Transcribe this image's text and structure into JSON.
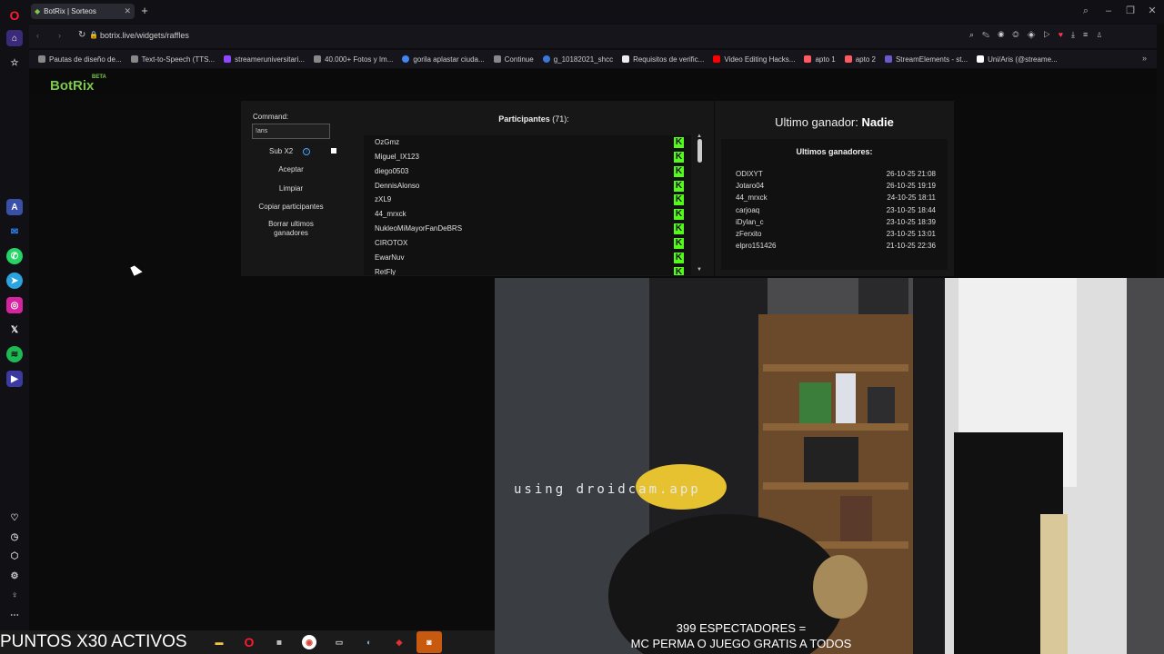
{
  "browser": {
    "tab_title": "BotRix | Sorteos",
    "url": "botrix.live/widgets/raffles",
    "bookmarks": [
      "Pautas de diseño de...",
      "Text-to-Speech (TTS...",
      "streameruniversitari...",
      "40.000+ Fotos y Im...",
      "gorila aplastar ciuda...",
      "Continue",
      "g_10182021_shcc",
      "Requisitos de verific...",
      "Video Editing Hacks...",
      "apto 1",
      "apto 2",
      "StreamElements - st...",
      "Uni/Aris (@streame..."
    ]
  },
  "botrix": {
    "logo": "BotRix",
    "beta": "BETA",
    "command_label": "Command:",
    "command_value": "!aris",
    "sub_label": "Sub X2",
    "buttons": [
      "Aceptar",
      "Limpiar",
      "Copiar participantes",
      "Borrar ultimos ganadores"
    ],
    "participants_label": "Participantes",
    "participants_count": "(71):",
    "participants": [
      "OzGmz",
      "Miguel_IX123",
      "diego0503",
      "DennisAlonso",
      "zXL9",
      "44_mrxck",
      "NukleoMiMayorFanDeBRS",
      "CIROTOX",
      "EwarNuv",
      "RetFly"
    ],
    "last_winner_label": "Ultimo ganador:",
    "last_winner": "Nadie",
    "recent_winners_title": "Ultimos ganadores:",
    "recent_winners": [
      {
        "name": "ODIXYT",
        "date": "26-10-25 21:08"
      },
      {
        "name": "Jotaro04",
        "date": "26-10-25 19:19"
      },
      {
        "name": "44_mrxck",
        "date": "24-10-25 18:11"
      },
      {
        "name": "carjoaq",
        "date": "23-10-25 18:44"
      },
      {
        "name": "iDylan_c",
        "date": "23-10-25 18:39"
      },
      {
        "name": "zFerxito",
        "date": "23-10-25 13:01"
      },
      {
        "name": "elpro151426",
        "date": "21-10-25 22:36"
      }
    ]
  },
  "stream": {
    "watermark": "using droidcam.app",
    "overlay_line1": "399 ESPECTADORES =",
    "overlay_line2": "MC PERMA O JUEGO GRATIS A TODOS",
    "ticker": "PUNTOS X30 ACTIVOS"
  },
  "colors": {
    "accent": "#7cc84b",
    "kick": "#53fc18",
    "opera_red": "#ff1b2d"
  }
}
